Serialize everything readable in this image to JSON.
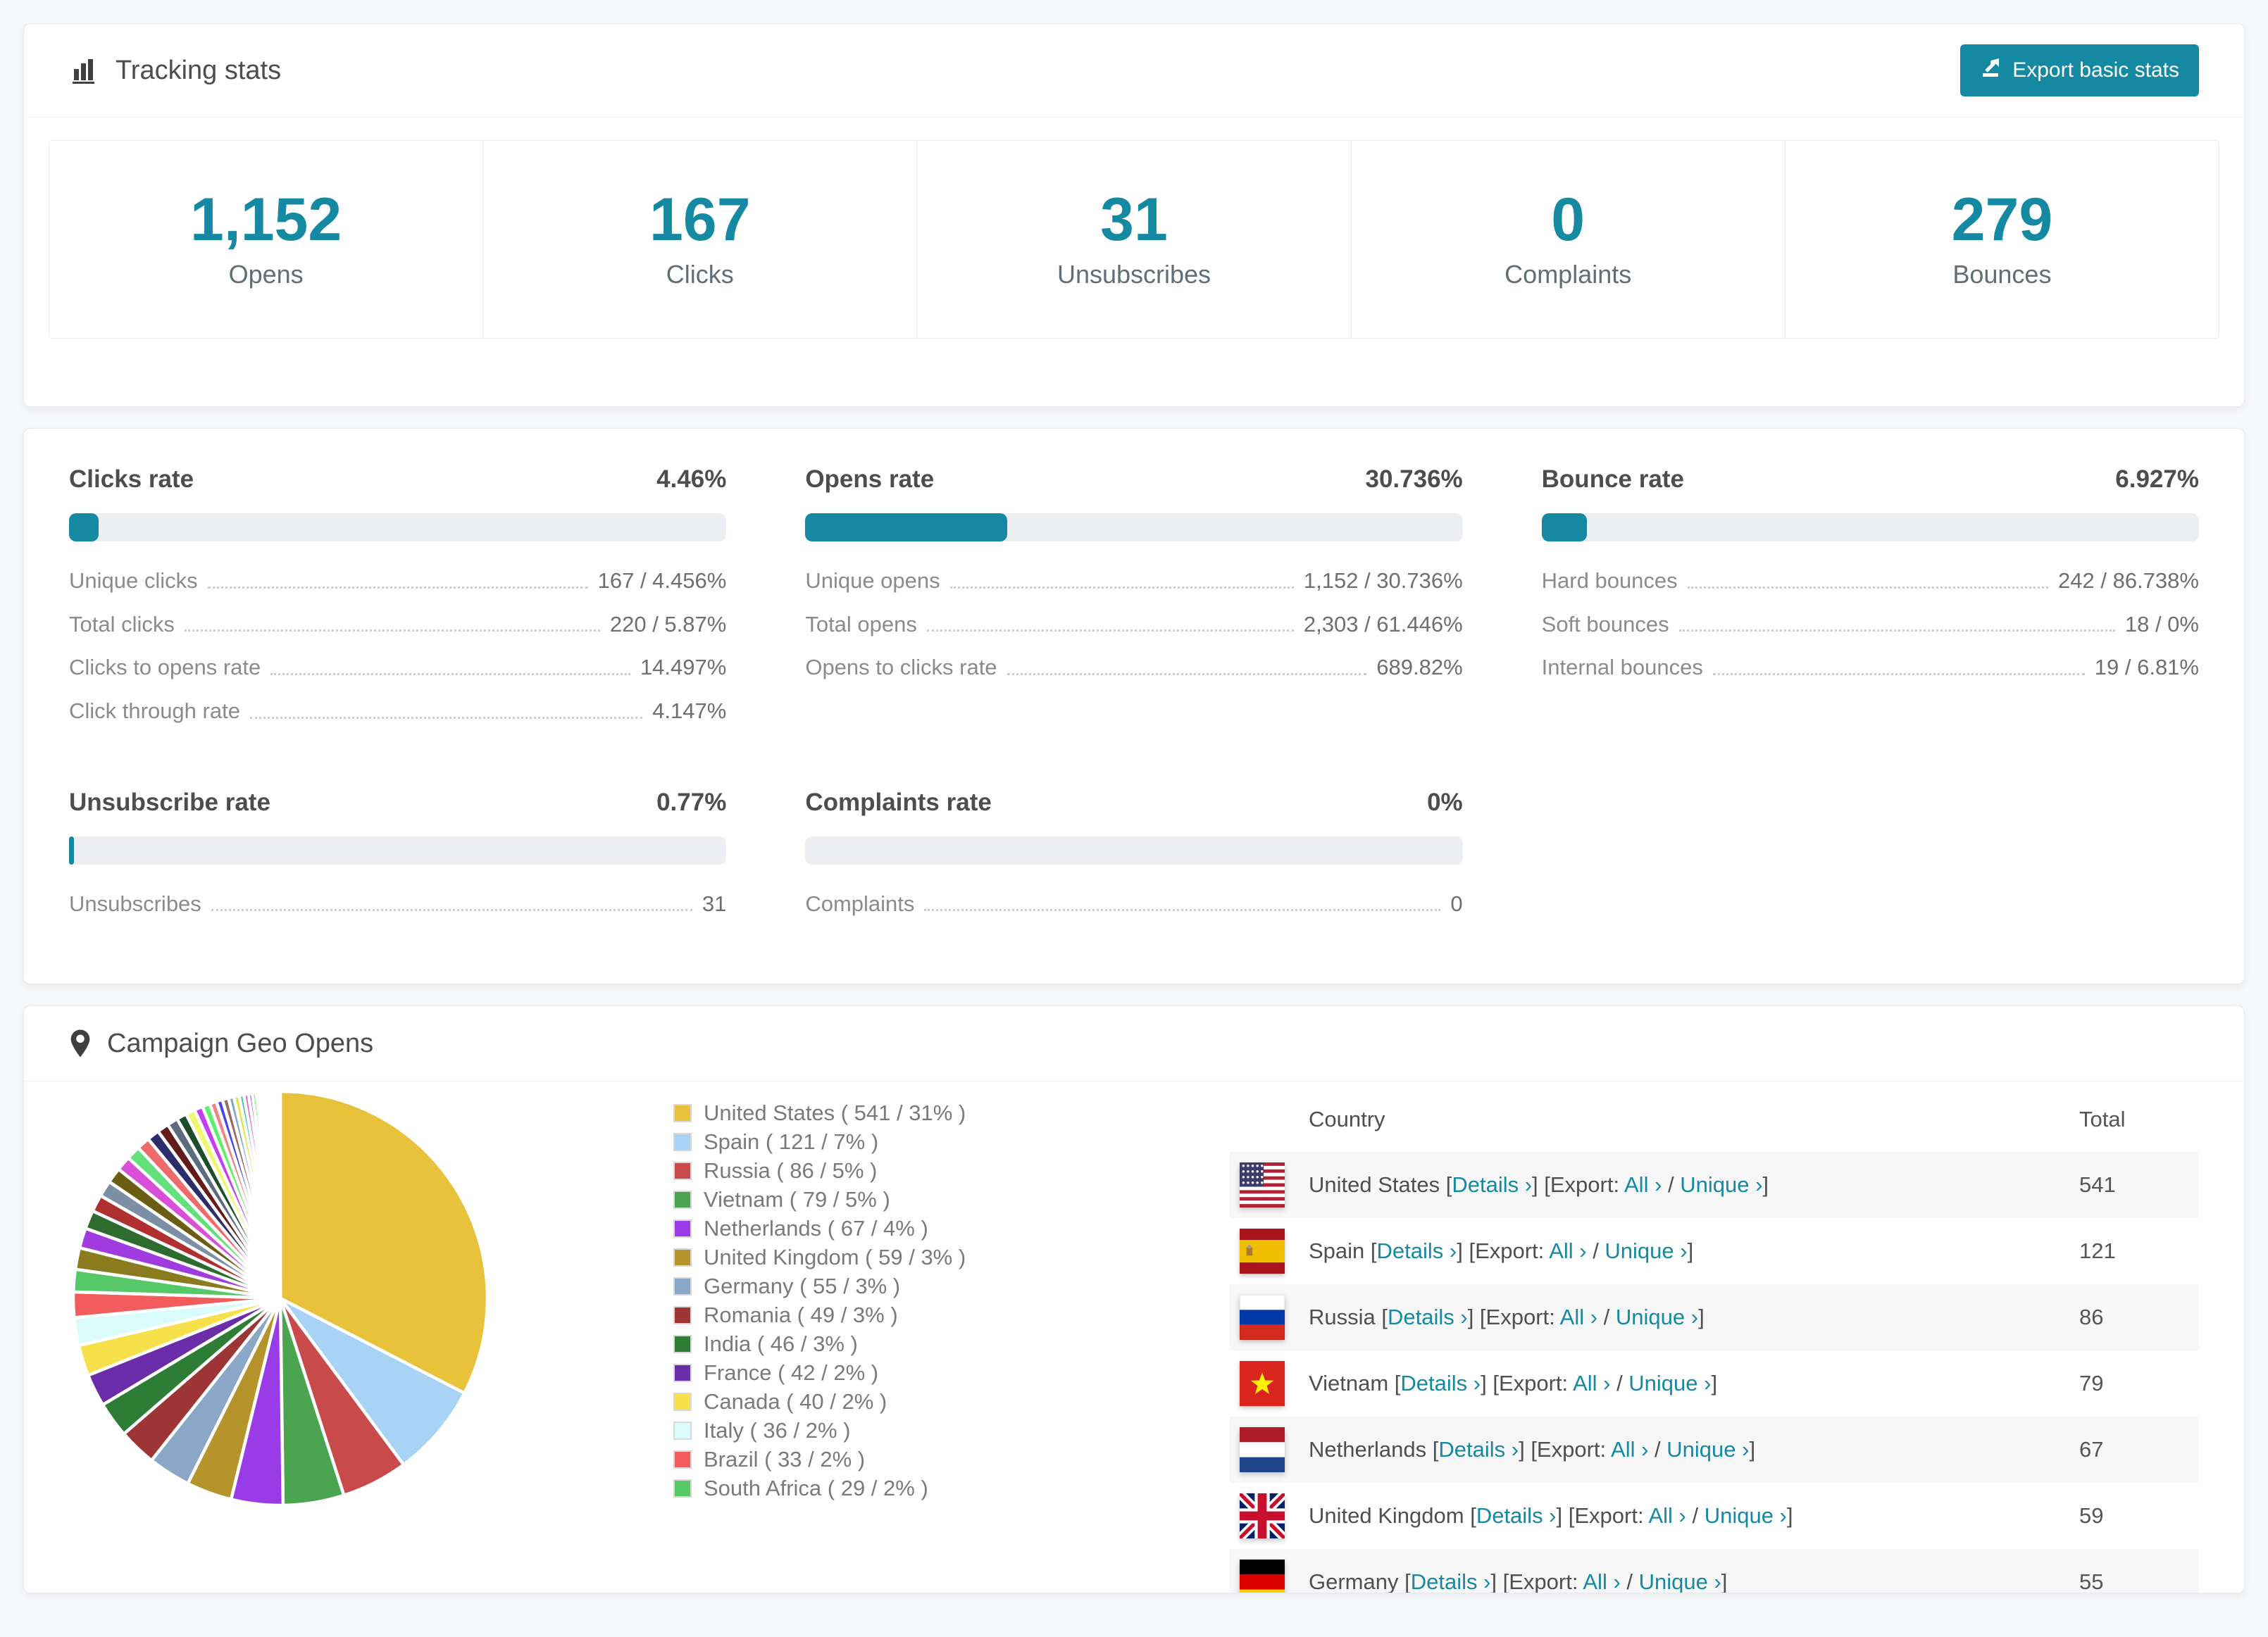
{
  "theme": {
    "accent": "#1689a2",
    "page_bg": "#f6f7f8",
    "bar_track": "#eceef1",
    "row_stripe": "#f7f7f8",
    "icon_color": "#3f3f3f"
  },
  "tracking": {
    "title": "Tracking stats",
    "title_icon": "bar-chart-icon",
    "export_button_label": "Export basic stats",
    "export_button_icon": "export-icon",
    "stats": [
      {
        "value": "1,152",
        "label": "Opens"
      },
      {
        "value": "167",
        "label": "Clicks"
      },
      {
        "value": "31",
        "label": "Unsubscribes"
      },
      {
        "value": "0",
        "label": "Complaints"
      },
      {
        "value": "279",
        "label": "Bounces"
      }
    ]
  },
  "rates": [
    {
      "title": "Clicks rate",
      "display": "4.46%",
      "percent": 4.46,
      "rows": [
        [
          "Unique clicks",
          "167 / 4.456%"
        ],
        [
          "Total clicks",
          "220 / 5.87%"
        ],
        [
          "Clicks to opens rate",
          "14.497%"
        ],
        [
          "Click through rate",
          "4.147%"
        ]
      ]
    },
    {
      "title": "Opens rate",
      "display": "30.736%",
      "percent": 30.736,
      "rows": [
        [
          "Unique opens",
          "1,152 / 30.736%"
        ],
        [
          "Total opens",
          "2,303 / 61.446%"
        ],
        [
          "Opens to clicks rate",
          "689.82%"
        ]
      ]
    },
    {
      "title": "Bounce rate",
      "display": "6.927%",
      "percent": 6.927,
      "rows": [
        [
          "Hard bounces",
          "242 / 86.738%"
        ],
        [
          "Soft bounces",
          "18 / 0%"
        ],
        [
          "Internal bounces",
          "19 / 6.81%"
        ]
      ]
    },
    {
      "title": "Unsubscribe rate",
      "display": "0.77%",
      "percent": 0.77,
      "rows": [
        [
          "Unsubscribes",
          "31"
        ]
      ]
    },
    {
      "title": "Complaints rate",
      "display": "0%",
      "percent": 0,
      "rows": [
        [
          "Complaints",
          "0"
        ]
      ]
    }
  ],
  "geo": {
    "title": "Campaign Geo Opens",
    "title_icon": "map-pin-icon",
    "table": {
      "columns": [
        "Country",
        "Total"
      ],
      "link_labels": {
        "details": "Details ›",
        "export_prefix": "Export:",
        "all": "All ›",
        "unique": "Unique ›"
      },
      "rows": [
        {
          "country": "United States",
          "flag": "us",
          "total": "541"
        },
        {
          "country": "Spain",
          "flag": "es",
          "total": "121"
        },
        {
          "country": "Russia",
          "flag": "ru",
          "total": "86"
        },
        {
          "country": "Vietnam",
          "flag": "vn",
          "total": "79"
        },
        {
          "country": "Netherlands",
          "flag": "nl",
          "total": "67"
        },
        {
          "country": "United Kingdom",
          "flag": "gb",
          "total": "59"
        },
        {
          "country": "Germany",
          "flag": "de",
          "total": "55",
          "partially_visible": true
        }
      ]
    }
  },
  "chart_data": {
    "type": "pie",
    "title": "Campaign Geo Opens",
    "legend_position": "right",
    "start_angle_deg": -90,
    "direction": "clockwise",
    "slices": [
      {
        "label": "United States",
        "value": 541,
        "percent": 31,
        "color": "#e8c23b"
      },
      {
        "label": "Spain",
        "value": 121,
        "percent": 7,
        "color": "#a9d3f5"
      },
      {
        "label": "Russia",
        "value": 86,
        "percent": 5,
        "color": "#c94a4a"
      },
      {
        "label": "Vietnam",
        "value": 79,
        "percent": 5,
        "color": "#4ba450"
      },
      {
        "label": "Netherlands",
        "value": 67,
        "percent": 4,
        "color": "#9a3be8"
      },
      {
        "label": "United Kingdom",
        "value": 59,
        "percent": 3,
        "color": "#b5952b"
      },
      {
        "label": "Germany",
        "value": 55,
        "percent": 3,
        "color": "#8ba7c7"
      },
      {
        "label": "Romania",
        "value": 49,
        "percent": 3,
        "color": "#9d3535"
      },
      {
        "label": "India",
        "value": 46,
        "percent": 3,
        "color": "#2e7d36"
      },
      {
        "label": "France",
        "value": 42,
        "percent": 2,
        "color": "#6a2ca8"
      },
      {
        "label": "Canada",
        "value": 40,
        "percent": 2,
        "color": "#f6e14b"
      },
      {
        "label": "Italy",
        "value": 36,
        "percent": 2,
        "color": "#d9fbfb"
      },
      {
        "label": "Brazil",
        "value": 33,
        "percent": 2,
        "color": "#f25c5c"
      },
      {
        "label": "South Africa",
        "value": 29,
        "percent": 2,
        "color": "#57c867"
      }
    ],
    "other_slices_estimated": {
      "note": "unlabeled small slices read from pie only",
      "values": [
        28,
        26,
        24,
        22,
        21,
        20,
        19,
        18,
        17,
        16,
        15,
        14,
        13,
        12,
        11,
        10,
        9,
        8,
        8,
        7,
        7,
        6,
        6,
        5,
        5,
        4,
        4,
        3,
        3,
        3,
        2,
        2,
        2,
        2,
        1,
        1,
        1,
        1,
        1,
        1
      ],
      "colors": [
        "#8a7c1e",
        "#a03be0",
        "#2e6b2e",
        "#b03030",
        "#7d8fa5",
        "#6b5d14",
        "#d84fd8",
        "#62e07c",
        "#ef6a6a",
        "#2c2e6b",
        "#641b1b",
        "#5c6c7c",
        "#1d4d2b",
        "#eef76e",
        "#c53ef0",
        "#5df06a",
        "#f08585",
        "#4343ef",
        "#9a6a6a",
        "#7da4c9",
        "#e3e338",
        "#3ec9a4",
        "#ef62c4",
        "#8a43ef",
        "#43ef43",
        "#efa443",
        "#4343a4",
        "#a4efef",
        "#ef4343",
        "#6aefa4",
        "#c9c943",
        "#6a43c9",
        "#43a46a",
        "#efc96a",
        "#c94343",
        "#a4a4ef",
        "#efefa4",
        "#b4b4b4",
        "#d0d0ff",
        "#ffd0d0"
      ]
    }
  }
}
